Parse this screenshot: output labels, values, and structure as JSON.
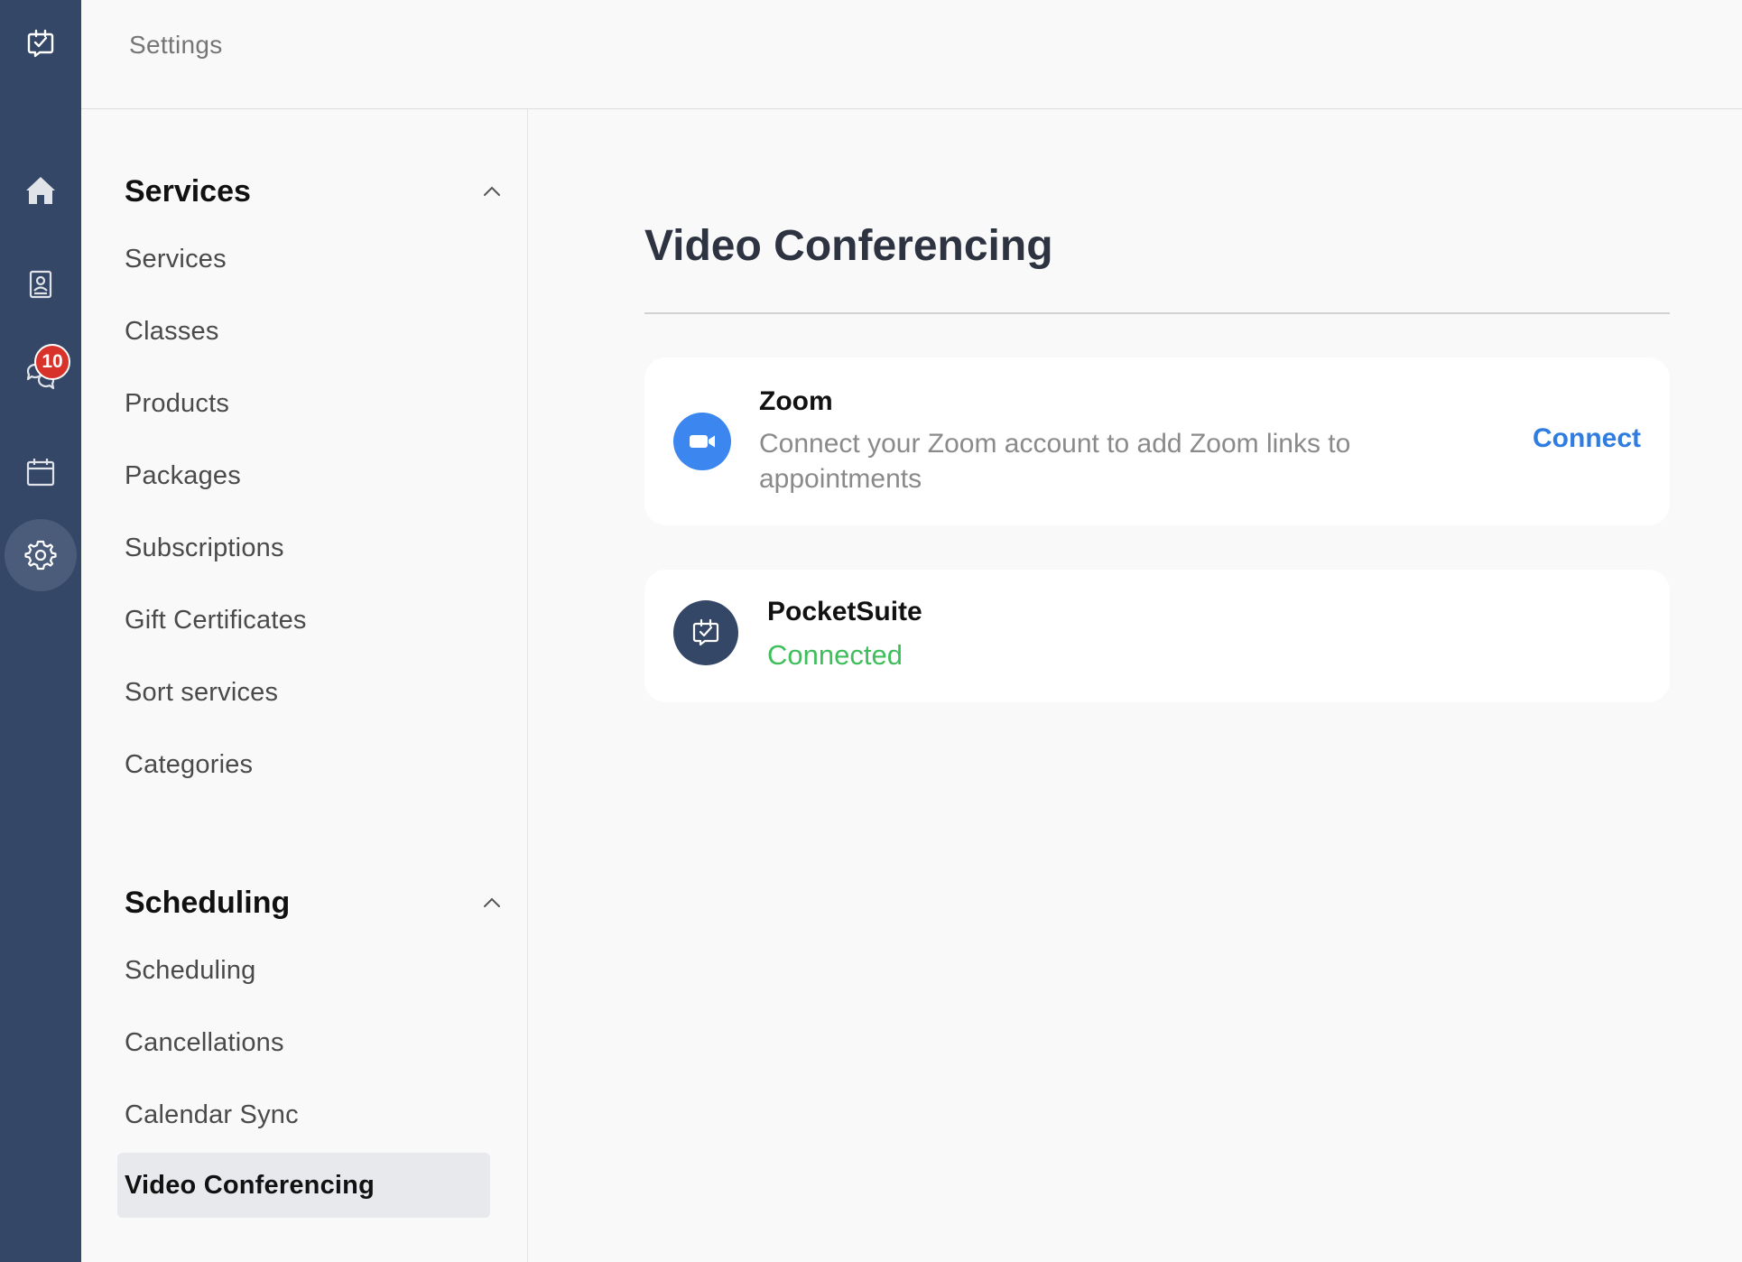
{
  "header": {
    "title": "Settings"
  },
  "rail": {
    "items": [
      {
        "icon": "app-logo-icon",
        "active": false
      },
      {
        "icon": "home-icon",
        "active": false
      },
      {
        "icon": "contacts-icon",
        "active": false
      },
      {
        "icon": "messages-icon",
        "active": false,
        "badge": "10"
      },
      {
        "icon": "calendar-icon",
        "active": false
      },
      {
        "icon": "gear-icon",
        "active": true
      }
    ],
    "messages_badge": "10"
  },
  "settings_nav": {
    "sections": [
      {
        "title": "Services",
        "expanded": true,
        "items": [
          "Services",
          "Classes",
          "Products",
          "Packages",
          "Subscriptions",
          "Gift Certificates",
          "Sort services",
          "Categories"
        ]
      },
      {
        "title": "Scheduling",
        "expanded": true,
        "items": [
          "Scheduling",
          "Cancellations",
          "Calendar Sync",
          "Video Conferencing"
        ],
        "active_item": "Video Conferencing"
      }
    ]
  },
  "main": {
    "title": "Video Conferencing",
    "integrations": [
      {
        "name": "Zoom",
        "description": "Connect your Zoom account to add Zoom links to appointments",
        "action_label": "Connect",
        "icon": "zoom-camera-icon",
        "icon_color": "#3c86f0"
      },
      {
        "name": "PocketSuite",
        "status": "Connected",
        "status_color": "#3ebf5b",
        "icon": "pocketsuite-logo-icon",
        "icon_color": "#344766"
      }
    ]
  },
  "colors": {
    "rail_bg": "#344766",
    "accent_link": "#2f7de1",
    "badge": "#d8332a",
    "success": "#3ebf5b"
  }
}
